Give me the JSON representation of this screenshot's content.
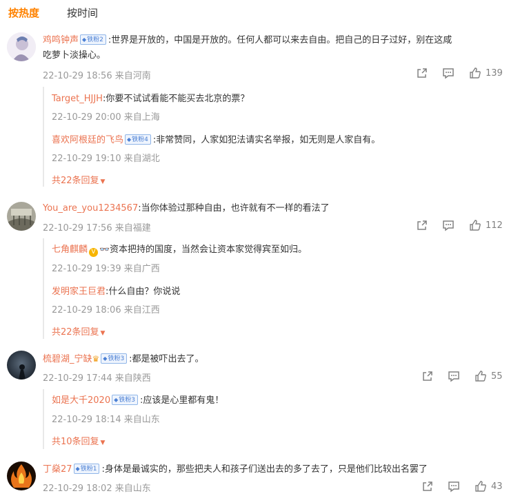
{
  "tabs": {
    "hot": "按热度",
    "time": "按时间"
  },
  "comments": [
    {
      "user": "鸡鸣钟声",
      "badge": "铁粉2",
      "text_line1": ":世界是开放的，中国是开放的。任何人都可以来去自由。把自己的日子过好，别在这咸",
      "text_line2": "吃萝卜淡操心。",
      "meta": "22-10-29 18:56 来自河南",
      "likes": "139",
      "replies": [
        {
          "user": "Target_HJJH",
          "text": ":你要不试试看能不能买去北京的票？",
          "meta": "22-10-29 20:00 来自上海"
        },
        {
          "user": "喜欢阿根廷的飞鸟",
          "badge": "铁粉4",
          "text": ":非常赞同，人家如犯法请实名举报，如无则是人家自有。",
          "meta": "22-10-29 19:10 来自湖北"
        }
      ],
      "more": "共22条回复"
    },
    {
      "user": "You_are_you1234567",
      "text_line1": ":当你体验过那种自由，也许就有不一样的看法了",
      "meta": "22-10-29 17:56 来自福建",
      "likes": "112",
      "replies": [
        {
          "user": "七角麒麟",
          "text": "资本把持的国度，当然会让资本家觉得宾至如归。",
          "meta": "22-10-29 19:39 来自广西"
        },
        {
          "user": "发明家王巨君",
          "text": ":什么自由？你说说",
          "meta": "22-10-29 18:06 来自江西"
        }
      ],
      "more": "共22条回复"
    },
    {
      "user": "梳碧湖_宁缺",
      "badge": "铁粉3",
      "text_line1": ":都是被吓出去了。",
      "meta": "22-10-29 17:44 来自陕西",
      "likes": "55",
      "replies": [
        {
          "user": "如是大千2020",
          "badge": "铁粉3",
          "text": ":应该是心里都有鬼！",
          "meta": "22-10-29 18:14 来自山东"
        }
      ],
      "more": "共10条回复"
    },
    {
      "user": "丁燊27",
      "badge": "铁粉1",
      "text_line1": ":身体是最诚实的，那些把夫人和孩子们送出去的多了去了，只是他们比较出名罢了",
      "meta": "22-10-29 18:02 来自山东",
      "likes": "43"
    }
  ],
  "icons": {
    "share": "share-icon",
    "comment": "comment-icon",
    "like": "like-icon",
    "expand": "caret-down-icon"
  },
  "colors": {
    "accent": "#ff8200",
    "username": "#eb7350",
    "meta": "#999999"
  }
}
